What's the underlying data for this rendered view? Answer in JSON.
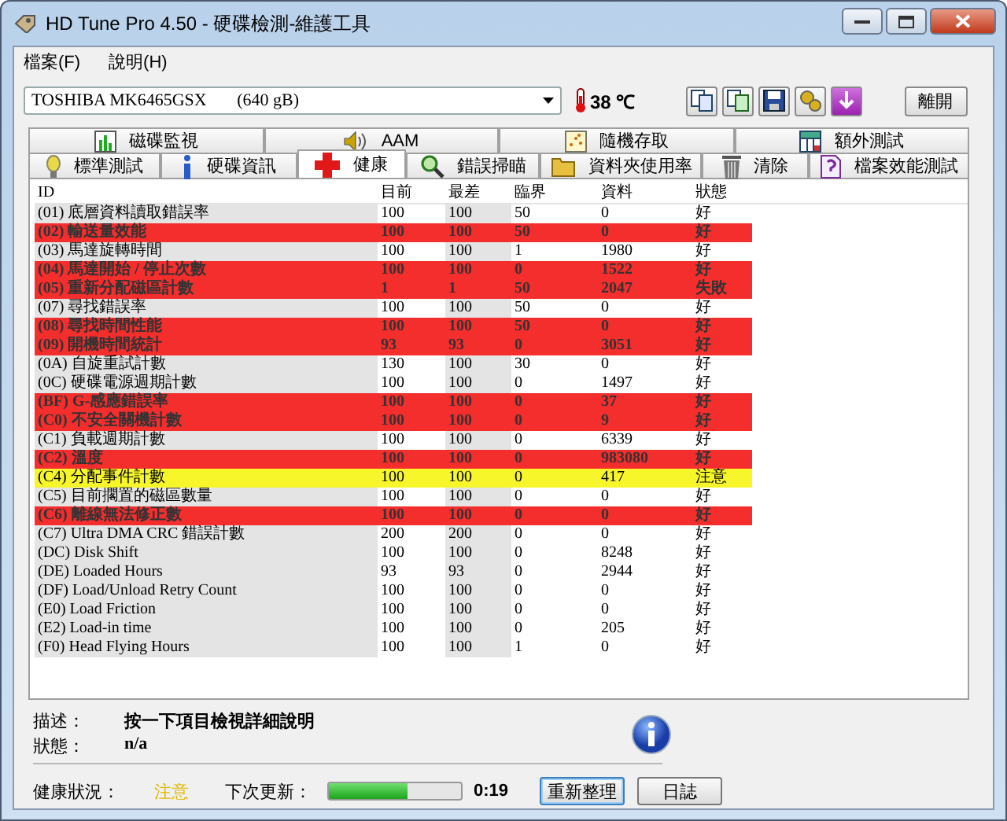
{
  "window": {
    "title": "HD Tune Pro 4.50 - 硬碟檢測-維護工具"
  },
  "menu": [
    "檔案(F)",
    "說明(H)"
  ],
  "toolbar": {
    "drive": "TOSHIBA MK6465GSX       (640 gB)",
    "temperature": "38 ℃",
    "exit_button": "離開"
  },
  "tabs_top": [
    {
      "label": "磁碟監視",
      "selected": false
    },
    {
      "label": "AAM",
      "selected": false
    },
    {
      "label": "隨機存取",
      "selected": false
    },
    {
      "label": "額外測試",
      "selected": false
    }
  ],
  "tabs_bottom": [
    {
      "label": "標準測試",
      "selected": false
    },
    {
      "label": "硬碟資訊",
      "selected": false
    },
    {
      "label": "健康",
      "selected": true
    },
    {
      "label": "錯誤掃瞄",
      "selected": false
    },
    {
      "label": "資料夾使用率",
      "selected": false
    },
    {
      "label": "清除",
      "selected": false
    },
    {
      "label": "檔案效能測試",
      "selected": false
    }
  ],
  "table": {
    "columns": [
      "ID",
      "目前",
      "最差",
      "臨界",
      "資料",
      "狀態"
    ],
    "rows": [
      {
        "kind": "normal",
        "cells": [
          "(01) 底層資料讀取錯誤率",
          "100",
          "100",
          "50",
          "0",
          "好"
        ]
      },
      {
        "kind": "failing",
        "cells": [
          "(02) 輸送量效能",
          "100",
          "100",
          "50",
          "0",
          "好"
        ]
      },
      {
        "kind": "normal",
        "cells": [
          "(03) 馬達旋轉時間",
          "100",
          "100",
          "1",
          "1980",
          "好"
        ]
      },
      {
        "kind": "failing",
        "cells": [
          "(04) 馬達開始 / 停止次數",
          "100",
          "100",
          "0",
          "1522",
          "好"
        ]
      },
      {
        "kind": "failing",
        "cells": [
          "(05) 重新分配磁區計數",
          "1",
          "1",
          "50",
          "2047",
          "失敗"
        ]
      },
      {
        "kind": "normal",
        "cells": [
          "(07) 尋找錯誤率",
          "100",
          "100",
          "50",
          "0",
          "好"
        ]
      },
      {
        "kind": "failing",
        "cells": [
          "(08) 尋找時間性能",
          "100",
          "100",
          "50",
          "0",
          "好"
        ]
      },
      {
        "kind": "failing",
        "cells": [
          "(09) 開機時間統計",
          "93",
          "93",
          "0",
          "3051",
          "好"
        ]
      },
      {
        "kind": "normal",
        "cells": [
          "(0A) 自旋重試計數",
          "130",
          "100",
          "30",
          "0",
          "好"
        ]
      },
      {
        "kind": "normal",
        "cells": [
          "(0C) 硬碟電源週期計數",
          "100",
          "100",
          "0",
          "1497",
          "好"
        ]
      },
      {
        "kind": "failing",
        "cells": [
          "(BF) G-感應錯誤率",
          "100",
          "100",
          "0",
          "37",
          "好"
        ]
      },
      {
        "kind": "failing",
        "cells": [
          "(C0) 不安全關機計數",
          "100",
          "100",
          "0",
          "9",
          "好"
        ]
      },
      {
        "kind": "normal",
        "cells": [
          "(C1) 負載週期計數",
          "100",
          "100",
          "0",
          "6339",
          "好"
        ]
      },
      {
        "kind": "failing",
        "cells": [
          "(C2) 溫度",
          "100",
          "100",
          "0",
          "983080",
          "好"
        ]
      },
      {
        "kind": "warning",
        "cells": [
          "(C4) 分配事件計數",
          "100",
          "100",
          "0",
          "417",
          "注意"
        ]
      },
      {
        "kind": "normal",
        "cells": [
          "(C5) 目前擱置的磁區數量",
          "100",
          "100",
          "0",
          "0",
          "好"
        ]
      },
      {
        "kind": "failing",
        "cells": [
          "(C6) 離線無法修正數",
          "100",
          "100",
          "0",
          "0",
          "好"
        ]
      },
      {
        "kind": "normal",
        "cells": [
          "(C7) Ultra DMA CRC 錯誤計數",
          "200",
          "200",
          "0",
          "0",
          "好"
        ]
      },
      {
        "kind": "normal",
        "cells": [
          "(DC) Disk Shift",
          "100",
          "100",
          "0",
          "8248",
          "好"
        ]
      },
      {
        "kind": "normal",
        "cells": [
          "(DE) Loaded Hours",
          "93",
          "93",
          "0",
          "2944",
          "好"
        ]
      },
      {
        "kind": "normal",
        "cells": [
          "(DF) Load/Unload Retry Count",
          "100",
          "100",
          "0",
          "0",
          "好"
        ]
      },
      {
        "kind": "normal",
        "cells": [
          "(E0) Load Friction",
          "100",
          "100",
          "0",
          "0",
          "好"
        ]
      },
      {
        "kind": "normal",
        "cells": [
          "(E2) Load-in time",
          "100",
          "100",
          "0",
          "205",
          "好"
        ]
      },
      {
        "kind": "normal",
        "cells": [
          "(F0) Head Flying Hours",
          "100",
          "100",
          "1",
          "0",
          "好"
        ]
      }
    ]
  },
  "details": {
    "description_label": "描述：",
    "description": "按一下項目檢視詳細說明",
    "status_label": "狀態：",
    "status": "n/a"
  },
  "status_bar": {
    "health_label": "健康狀況：",
    "health": "注意",
    "next_update_label": "下次更新：",
    "countdown": {
      "level": 0.6
    },
    "time": "0:19",
    "refresh_button": "重新整理",
    "log_button": "日誌"
  }
}
